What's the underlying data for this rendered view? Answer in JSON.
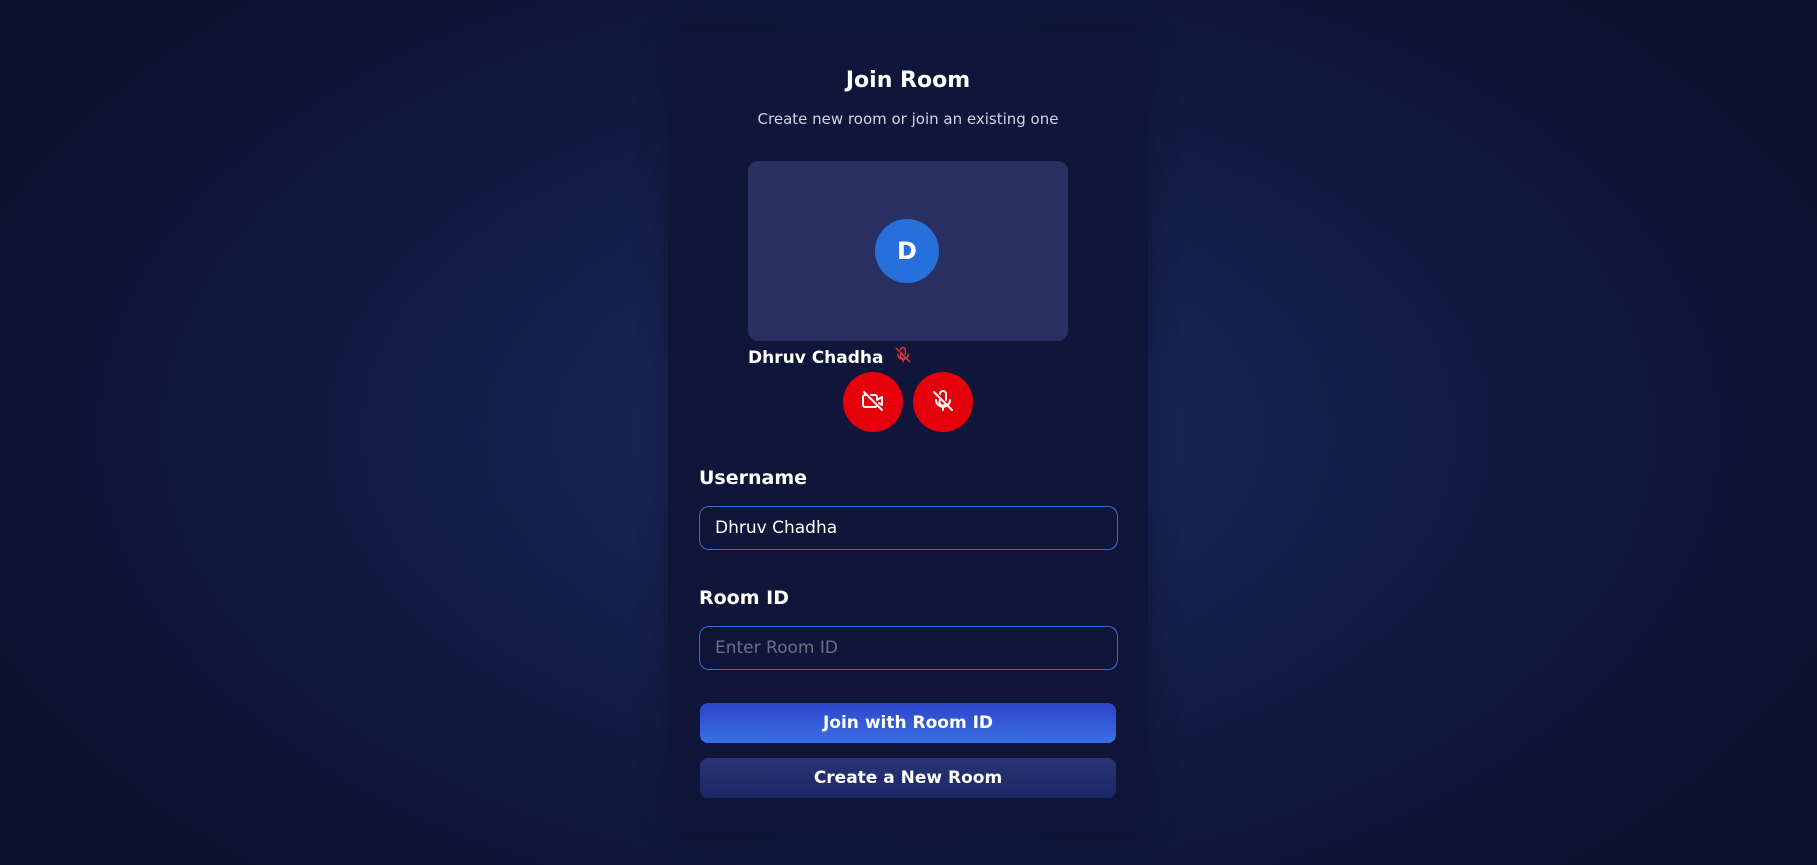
{
  "header": {
    "title": "Join Room",
    "subtitle": "Create new room or join an existing one"
  },
  "preview": {
    "avatar_initial": "D",
    "name": "Dhruv Chadha",
    "mic_status_icon": "mic-off-icon",
    "camera_button_icon": "video-off-icon",
    "mic_button_icon": "mic-off-icon"
  },
  "form": {
    "username_label": "Username",
    "username_value": "Dhruv Chadha",
    "room_label": "Room ID",
    "room_placeholder": "Enter Room ID",
    "room_value": "",
    "join_label": "Join with Room ID",
    "create_label": "Create a New Room"
  },
  "colors": {
    "accent": "#2a6ee0",
    "danger": "#e5000c",
    "avatar": "#2770dc"
  }
}
